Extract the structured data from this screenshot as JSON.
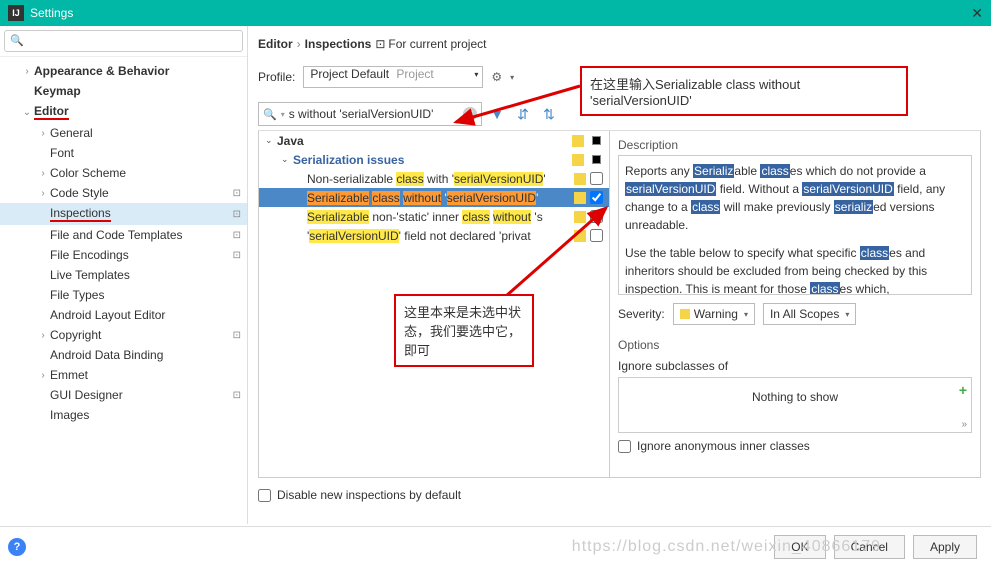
{
  "window": {
    "title": "Settings"
  },
  "sidebar": {
    "items": [
      {
        "label": "Appearance & Behavior",
        "chev": "›",
        "bold": true
      },
      {
        "label": "Keymap",
        "chev": "",
        "bold": true
      },
      {
        "label": "Editor",
        "chev": "⌄",
        "bold": true,
        "underline": true
      },
      {
        "label": "General",
        "chev": "›"
      },
      {
        "label": "Font",
        "chev": ""
      },
      {
        "label": "Color Scheme",
        "chev": "›"
      },
      {
        "label": "Code Style",
        "chev": "›",
        "copy": true
      },
      {
        "label": "Inspections",
        "chev": "",
        "copy": true,
        "selected": true,
        "underline": true
      },
      {
        "label": "File and Code Templates",
        "chev": "",
        "copy": true
      },
      {
        "label": "File Encodings",
        "chev": "",
        "copy": true
      },
      {
        "label": "Live Templates",
        "chev": ""
      },
      {
        "label": "File Types",
        "chev": ""
      },
      {
        "label": "Android Layout Editor",
        "chev": ""
      },
      {
        "label": "Copyright",
        "chev": "›",
        "copy": true
      },
      {
        "label": "Android Data Binding",
        "chev": ""
      },
      {
        "label": "Emmet",
        "chev": "›"
      },
      {
        "label": "GUI Designer",
        "chev": "",
        "copy": true
      },
      {
        "label": "Images",
        "chev": ""
      }
    ]
  },
  "breadcrumb": {
    "a": "Editor",
    "b": "Inspections",
    "proj": "For current project"
  },
  "profile": {
    "label": "Profile:",
    "value": "Project Default",
    "scope": "Project"
  },
  "filter": {
    "value": "s without 'serialVersionUID'"
  },
  "insp": {
    "java": "Java",
    "group": "Serialization issues",
    "rows": [
      "Non-serializable |class| with '|serialVersionUID|'",
      "|Serializable| |class| |without| '|serialVersionUID|'",
      "|Serializable| non-'static' inner |class| |without| 's",
      "'|serialVersionUID|' field not declared 'privat"
    ]
  },
  "desc": {
    "title": "Description",
    "text": "Reports any |Serializ|able |class|es which do not provide a |serialVersionUID| field. Without a |serialVersionUID| field, any change to a |class| will make previously |serializ|ed versions unreadable.\n\nUse the table below to specify what specific |class|es and inheritors should be excluded from being checked by this inspection. This is meant for those |class|es which,"
  },
  "severity": {
    "label": "Severity:",
    "value": "Warning",
    "scope": "In All Scopes"
  },
  "options": {
    "title": "Options",
    "ignore": "Ignore subclasses of",
    "nothing": "Nothing to show",
    "anon": "Ignore anonymous inner classes"
  },
  "disable": "Disable new inspections by default",
  "buttons": {
    "ok": "OK",
    "cancel": "Cancel",
    "apply": "Apply"
  },
  "annot1": "在这里输入Serializable class without 'serialVersionUID'",
  "annot2": "这里本来是未选中状态，我们要选中它，即可",
  "watermark": "https://blog.csdn.net/weixin_40866179"
}
